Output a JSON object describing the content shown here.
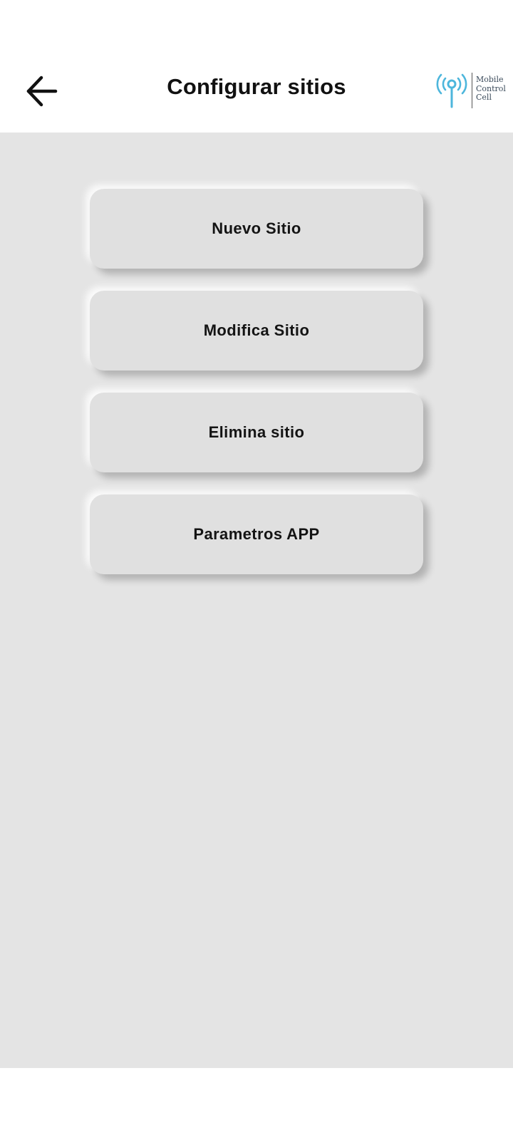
{
  "header": {
    "title": "Configurar sitios",
    "back_icon": "arrow-left-icon",
    "logo": {
      "icon": "antenna-signal-icon",
      "lines": [
        "Mobile",
        "Control",
        "Cell"
      ],
      "accent_color": "#4db6dc"
    }
  },
  "menu": {
    "items": [
      {
        "label": "Nuevo Sitio"
      },
      {
        "label": "Modifica Sitio"
      },
      {
        "label": "Elimina sitio"
      },
      {
        "label": "Parametros APP"
      }
    ]
  },
  "colors": {
    "content_background": "#e4e4e4",
    "button_background": "#e0e0e0",
    "text": "#111111"
  }
}
